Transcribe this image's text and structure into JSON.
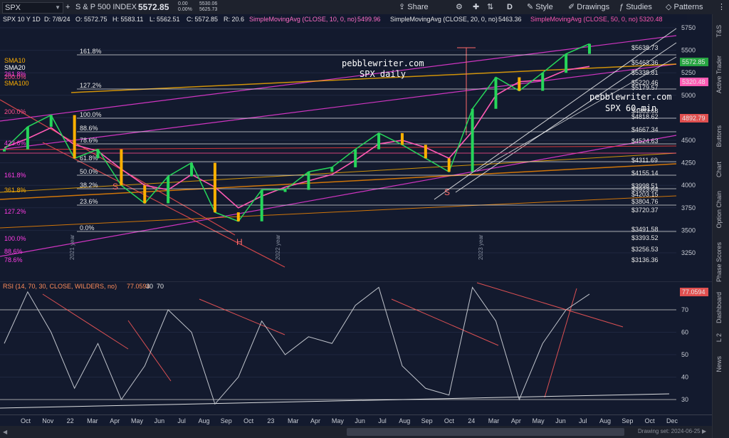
{
  "toolbar": {
    "symbol": "SPX",
    "symbol_name": "S & P 500 INDEX",
    "last_price": "5572.85",
    "change": "0.00",
    "change_pct": "0.00%",
    "bid": "5530.06",
    "ask": "5625.73",
    "share": "Share",
    "interval": "D",
    "style": "Style",
    "drawings": "Drawings",
    "studies": "Studies",
    "patterns": "Patterns"
  },
  "legend": {
    "title": "SPX 10 Y 1D",
    "date": "D: 7/8/24",
    "open": "O: 5572.75",
    "high": "H: 5583.11",
    "low": "L: 5562.51",
    "close": "C: 5572.85",
    "range": "R: 20.6",
    "sma10": "SimpleMovingAvg (CLOSE, 10, 0, no)",
    "sma10_val": "5499.96",
    "sma20": "SimpleMovingAvg (CLOSE, 20, 0, no)",
    "sma20_val": "5463.36",
    "sma50": "SimpleMovingAvg (CLOSE, 50, 0, no)",
    "sma50_val": "5320.48"
  },
  "rsi_legend": {
    "label": "RSI (14, 70, 30, CLOSE, WILDERS, no)",
    "value": "77.0594",
    "ob": "30",
    "os": "70"
  },
  "annotations": {
    "site1": "pebblewriter.com",
    "site1_sub": "SPX daily",
    "site2": "pebblewriter.com",
    "site2_sub": "SPX 60-min",
    "label_s_left": "S",
    "label_h": "H",
    "label_s_right": "S",
    "year_2021": "2021 year",
    "year_2022": "2022 year",
    "year_2023": "2023 year"
  },
  "fib_labels": [
    "161.8%",
    "127.2%",
    "100.0%",
    "88.6%",
    "78.6%",
    "61.8%",
    "50.0%",
    "38.2%",
    "23.6%",
    "0.0%"
  ],
  "left_labels": [
    "SMA10",
    "SMA20",
    "261.8%",
    "200.0%",
    "SMA100",
    "200.0%",
    "423.6%",
    "161.8%",
    "361.8%",
    "127.2%",
    "100.0%",
    "88.6%",
    "78.6%"
  ],
  "level_labels": [
    "$5638.73",
    "$5463.36",
    "$5338.81",
    "$5220.46",
    "$5179.57",
    "$4883.68",
    "$4818.62",
    "$4667.34",
    "$4524.63",
    "$4311.69",
    "$4155.14",
    "$3998.51",
    "$3804.76",
    "$3720.37",
    "$3491.58",
    "$3393.52",
    "$3256.53",
    "$3136.36",
    "$3923.64",
    "$4203.15"
  ],
  "price_scale": [
    "5750",
    "5500",
    "5250",
    "5000",
    "4750",
    "4500",
    "4250",
    "4000",
    "3750",
    "3500",
    "3250"
  ],
  "rsi_scale": [
    "70",
    "60",
    "50",
    "40",
    "30"
  ],
  "price_tags": {
    "last": "5572.85",
    "sma50": "5320.48",
    "level_red": "4892.79",
    "rsi": "77.0594"
  },
  "x_axis": [
    "Oct",
    "Nov",
    "22",
    "Mar",
    "Apr",
    "May",
    "Jun",
    "Jul",
    "Aug",
    "Sep",
    "Oct",
    "23",
    "Mar",
    "Apr",
    "May",
    "Jun",
    "Jul",
    "Aug",
    "Sep",
    "Oct",
    "24",
    "Mar",
    "Apr",
    "May",
    "Jun",
    "Jul",
    "Aug",
    "Sep",
    "Oct",
    "Dec"
  ],
  "right_panel": [
    "T&S",
    "Active Trader",
    "Buttons",
    "Chart",
    "Option Chain",
    "Phase Scores",
    "Dashboard",
    "L 2",
    "News"
  ],
  "scroll_text": "Drawing set: 2024-06-25",
  "colors": {
    "background": "#131a2e",
    "candle_up": "#26d65a",
    "candle_down": "#ffb000",
    "sma10": "#ff69b4",
    "sma20": "#ff6ec7",
    "sma50": "#ff5ab4",
    "fib": "#ffffff",
    "channel_pink": "#ff3ce6",
    "channel_orange": "#ff8c00",
    "red_line": "#ff4040",
    "rsi": "#c0c4cc"
  },
  "chart_data": {
    "type": "line",
    "title": "SPX 10 Y 1D",
    "xlabel": "",
    "ylabel": "",
    "ylim": [
      3100,
      5900
    ],
    "x": [
      "2021-10",
      "2021-11",
      "2022-01",
      "2022-03",
      "2022-04",
      "2022-05",
      "2022-06",
      "2022-07",
      "2022-08",
      "2022-09",
      "2022-10",
      "2023-01",
      "2023-03",
      "2023-04",
      "2023-05",
      "2023-06",
      "2023-07",
      "2023-08",
      "2023-09",
      "2023-10",
      "2024-01",
      "2024-03",
      "2024-04",
      "2024-05",
      "2024-06",
      "2024-07"
    ],
    "series": [
      {
        "name": "SPX",
        "values": [
          4400,
          4650,
          4780,
          4300,
          4400,
          4000,
          3800,
          4100,
          4250,
          3700,
          3600,
          3950,
          3950,
          4150,
          4200,
          4400,
          4580,
          4450,
          4300,
          4150,
          4850,
          5200,
          5050,
          5250,
          5460,
          5572
        ]
      },
      {
        "name": "SimpleMovingAvg (CLOSE, 50, 0, no)",
        "values": [
          4420,
          4520,
          4640,
          4450,
          4380,
          4180,
          4000,
          3950,
          4120,
          3980,
          3750,
          3880,
          3980,
          4050,
          4120,
          4280,
          4460,
          4500,
          4420,
          4300,
          4600,
          5000,
          5150,
          5170,
          5280,
          5320
        ]
      }
    ],
    "rsi": {
      "name": "RSI (14, 70, 30, CLOSE, WILDERS, no)",
      "ylim": [
        25,
        85
      ],
      "levels": [
        70,
        30
      ],
      "values": [
        55,
        78,
        60,
        35,
        55,
        30,
        45,
        70,
        60,
        28,
        40,
        65,
        50,
        58,
        55,
        72,
        80,
        45,
        35,
        32,
        80,
        65,
        30,
        55,
        70,
        77
      ]
    }
  }
}
